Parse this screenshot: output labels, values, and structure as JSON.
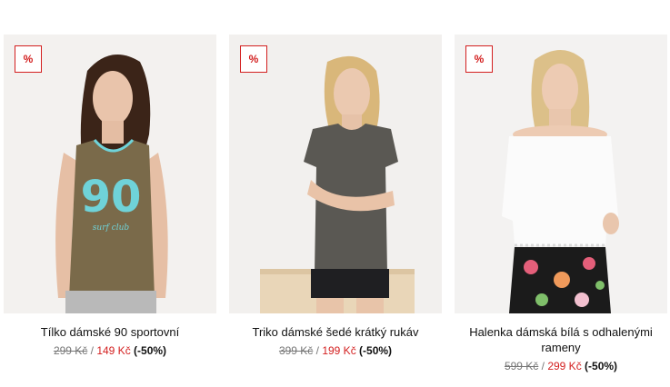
{
  "products": [
    {
      "badge": "%",
      "name": "Tílko dámské 90 sportovní",
      "old_price": "299 Kč",
      "separator": "/",
      "new_price": "149 Kč",
      "discount": "(-50%)",
      "print_number": "90",
      "print_text": "surf club"
    },
    {
      "badge": "%",
      "name": "Triko dámské šedé krátký rukáv",
      "old_price": "399 Kč",
      "separator": "/",
      "new_price": "199 Kč",
      "discount": "(-50%)"
    },
    {
      "badge": "%",
      "name": "Halenka dámská bílá s odhalenými rameny",
      "old_price": "599 Kč",
      "separator": "/",
      "new_price": "299 Kč",
      "discount": "(-50%)"
    }
  ],
  "colors": {
    "accent": "#d31f1f",
    "old_price": "#777777",
    "photo_bg": "#f2f0ee"
  }
}
